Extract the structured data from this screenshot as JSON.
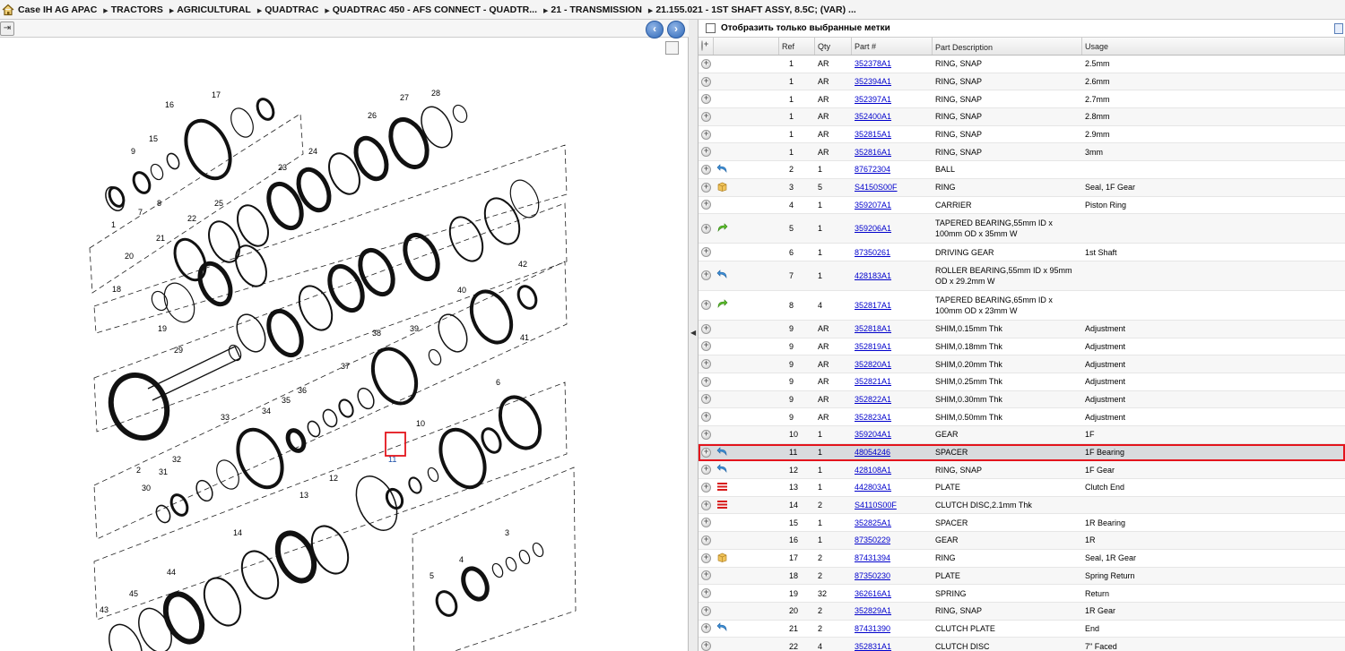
{
  "breadcrumb": [
    "Case IH AG APAC",
    "TRACTORS",
    "AGRICULTURAL",
    "QUADTRAC",
    "QUADTRAC 450 - AFS CONNECT - QUADTR...",
    "21 - TRANSMISSION",
    "21.155.021 - 1ST SHAFT ASSY, 8.5C; (VAR) ..."
  ],
  "filter_label": "Отобразить только выбранные метки",
  "columns": {
    "ref": "Ref",
    "qty": "Qty",
    "part": "Part #",
    "desc": "Part Description",
    "usage": "Usage"
  },
  "diagram_labels": [
    "1",
    "2",
    "3",
    "4",
    "5",
    "6",
    "7",
    "8",
    "9",
    "10",
    "11",
    "12",
    "13",
    "14",
    "15",
    "16",
    "17",
    "18",
    "19",
    "20",
    "21",
    "22",
    "23",
    "24",
    "25",
    "26",
    "27",
    "28",
    "29",
    "30",
    "31",
    "32",
    "33",
    "34",
    "35",
    "36",
    "37",
    "38",
    "39",
    "40",
    "41",
    "42",
    "43",
    "44",
    "45"
  ],
  "selected_callout": "11",
  "rows": [
    {
      "icon": "",
      "ref": "1",
      "qty": "AR",
      "part": "352378A1",
      "desc": "RING, SNAP",
      "usage": "2.5mm"
    },
    {
      "icon": "",
      "ref": "1",
      "qty": "AR",
      "part": "352394A1",
      "desc": "RING, SNAP",
      "usage": "2.6mm"
    },
    {
      "icon": "",
      "ref": "1",
      "qty": "AR",
      "part": "352397A1",
      "desc": "RING, SNAP",
      "usage": "2.7mm"
    },
    {
      "icon": "",
      "ref": "1",
      "qty": "AR",
      "part": "352400A1",
      "desc": "RING, SNAP",
      "usage": "2.8mm"
    },
    {
      "icon": "",
      "ref": "1",
      "qty": "AR",
      "part": "352815A1",
      "desc": "RING, SNAP",
      "usage": "2.9mm"
    },
    {
      "icon": "",
      "ref": "1",
      "qty": "AR",
      "part": "352816A1",
      "desc": "RING, SNAP",
      "usage": "3mm"
    },
    {
      "icon": "return-arrow-icon",
      "ref": "2",
      "qty": "1",
      "part": "87672304",
      "desc": "BALL",
      "usage": ""
    },
    {
      "icon": "box-icon",
      "ref": "3",
      "qty": "5",
      "part": "S4150S00F",
      "desc": "RING",
      "usage": "Seal, 1F Gear"
    },
    {
      "icon": "",
      "ref": "4",
      "qty": "1",
      "part": "359207A1",
      "desc": "CARRIER",
      "usage": "Piston Ring"
    },
    {
      "icon": "forward-arrow-icon",
      "ref": "5",
      "qty": "1",
      "part": "359206A1",
      "desc": "TAPERED BEARING,55mm ID x 100mm OD x 35mm W",
      "usage": ""
    },
    {
      "icon": "",
      "ref": "6",
      "qty": "1",
      "part": "87350261",
      "desc": "DRIVING GEAR",
      "usage": "1st Shaft"
    },
    {
      "icon": "return-arrow-icon",
      "ref": "7",
      "qty": "1",
      "part": "428183A1",
      "desc": "ROLLER BEARING,55mm ID x 95mm OD x 29.2mm W",
      "usage": ""
    },
    {
      "icon": "forward-arrow-icon",
      "ref": "8",
      "qty": "4",
      "part": "352817A1",
      "desc": "TAPERED BEARING,65mm ID x 100mm OD x 23mm W",
      "usage": ""
    },
    {
      "icon": "",
      "ref": "9",
      "qty": "AR",
      "part": "352818A1",
      "desc": "SHIM,0.15mm Thk",
      "usage": "Adjustment"
    },
    {
      "icon": "",
      "ref": "9",
      "qty": "AR",
      "part": "352819A1",
      "desc": "SHIM,0.18mm Thk",
      "usage": "Adjustment"
    },
    {
      "icon": "",
      "ref": "9",
      "qty": "AR",
      "part": "352820A1",
      "desc": "SHIM,0.20mm Thk",
      "usage": "Adjustment"
    },
    {
      "icon": "",
      "ref": "9",
      "qty": "AR",
      "part": "352821A1",
      "desc": "SHIM,0.25mm Thk",
      "usage": "Adjustment"
    },
    {
      "icon": "",
      "ref": "9",
      "qty": "AR",
      "part": "352822A1",
      "desc": "SHIM,0.30mm Thk",
      "usage": "Adjustment"
    },
    {
      "icon": "",
      "ref": "9",
      "qty": "AR",
      "part": "352823A1",
      "desc": "SHIM,0.50mm Thk",
      "usage": "Adjustment"
    },
    {
      "icon": "",
      "ref": "10",
      "qty": "1",
      "part": "359204A1",
      "desc": "GEAR",
      "usage": "1F"
    },
    {
      "icon": "return-arrow-icon",
      "ref": "11",
      "qty": "1",
      "part": "48054246",
      "desc": "SPACER",
      "usage": "1F Bearing",
      "selected": true
    },
    {
      "icon": "return-arrow-icon",
      "ref": "12",
      "qty": "1",
      "part": "428108A1",
      "desc": "RING, SNAP",
      "usage": "1F Gear"
    },
    {
      "icon": "stack-icon",
      "ref": "13",
      "qty": "1",
      "part": "442803A1",
      "desc": "PLATE",
      "usage": "Clutch End"
    },
    {
      "icon": "stack-icon",
      "ref": "14",
      "qty": "2",
      "part": "S4110S00F",
      "desc": "CLUTCH DISC,2.1mm Thk",
      "usage": ""
    },
    {
      "icon": "",
      "ref": "15",
      "qty": "1",
      "part": "352825A1",
      "desc": "SPACER",
      "usage": "1R Bearing"
    },
    {
      "icon": "",
      "ref": "16",
      "qty": "1",
      "part": "87350229",
      "desc": "GEAR",
      "usage": "1R"
    },
    {
      "icon": "box-icon",
      "ref": "17",
      "qty": "2",
      "part": "87431394",
      "desc": "RING",
      "usage": "Seal, 1R Gear"
    },
    {
      "icon": "",
      "ref": "18",
      "qty": "2",
      "part": "87350230",
      "desc": "PLATE",
      "usage": "Spring Return"
    },
    {
      "icon": "",
      "ref": "19",
      "qty": "32",
      "part": "362616A1",
      "desc": "SPRING",
      "usage": "Return"
    },
    {
      "icon": "",
      "ref": "20",
      "qty": "2",
      "part": "352829A1",
      "desc": "RING, SNAP",
      "usage": "1R Gear"
    },
    {
      "icon": "return-arrow-icon",
      "ref": "21",
      "qty": "2",
      "part": "87431390",
      "desc": "CLUTCH PLATE",
      "usage": "End"
    },
    {
      "icon": "",
      "ref": "22",
      "qty": "4",
      "part": "352831A1",
      "desc": "CLUTCH DISC",
      "usage": "7\" Faced"
    }
  ]
}
